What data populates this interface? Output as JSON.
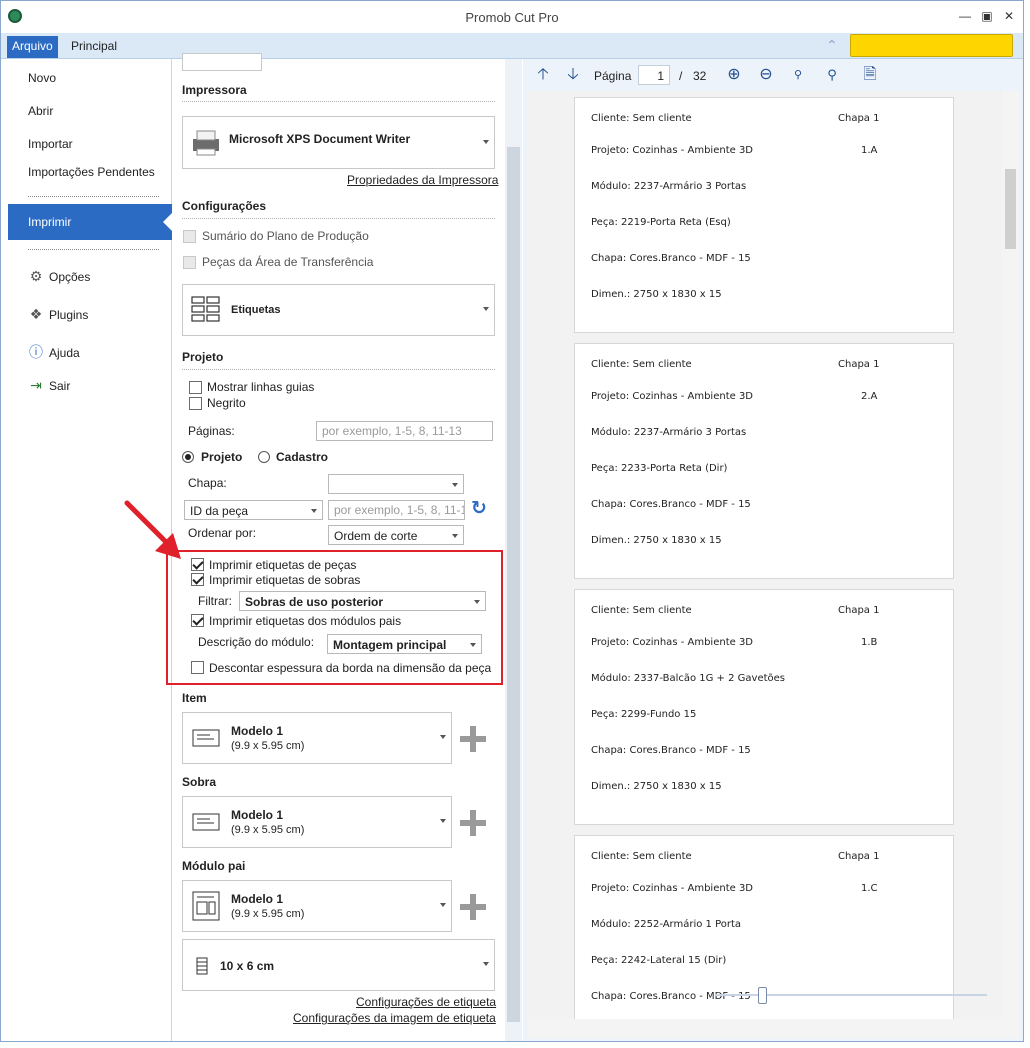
{
  "window": {
    "title": "Promob Cut Pro"
  },
  "menubar": {
    "tabs": [
      "Arquivo",
      "Principal"
    ]
  },
  "sidebar": {
    "items": [
      "Novo",
      "Abrir",
      "Importar",
      "Importações Pendentes",
      "Imprimir",
      "Opções",
      "Plugins",
      "Ajuda",
      "Sair"
    ],
    "active": "Imprimir"
  },
  "printer": {
    "section": "Impressora",
    "name": "Microsoft XPS Document Writer",
    "properties_link": "Propriedades da Impressora"
  },
  "config": {
    "section": "Configurações",
    "opt1": "Sumário do Plano de Produção",
    "opt2": "Peças da Área de Transferência",
    "type": "Etiquetas"
  },
  "project": {
    "section": "Projeto",
    "show_guides": "Mostrar linhas guias",
    "bold": "Negrito",
    "pages_label": "Páginas:",
    "pages_placeholder": "por exemplo, 1-5, 8, 11-13",
    "radio_project": "Projeto",
    "radio_cadastro": "Cadastro",
    "chapa_label": "Chapa:",
    "id_select": "ID da peça",
    "id_placeholder": "por exemplo, 1-5, 8, 11-13",
    "order_label": "Ordenar por:",
    "order_value": "Ordem de corte"
  },
  "labels": {
    "print_parts": "Imprimir etiquetas de peças",
    "print_leftovers": "Imprimir etiquetas de sobras",
    "filter_label": "Filtrar:",
    "filter_value": "Sobras de uso posterior",
    "print_parent_modules": "Imprimir etiquetas dos módulos pais",
    "module_desc_label": "Descrição do módulo:",
    "module_desc_value": "Montagem principal",
    "discount_edge": "Descontar espessura da borda na dimensão da peça"
  },
  "item": {
    "section": "Item",
    "model": "Modelo 1",
    "size": "(9.9 x 5.95 cm)"
  },
  "sobra": {
    "section": "Sobra",
    "model": "Modelo 1",
    "size": "(9.9 x 5.95 cm)"
  },
  "modulo": {
    "section": "Módulo pai",
    "model": "Modelo 1",
    "size": "(9.9 x 5.95 cm)"
  },
  "label_size": "10 x 6 cm",
  "links": {
    "label_config": "Configurações de etiqueta",
    "label_image_config": "Configurações da imagem de etiqueta"
  },
  "preview_toolbar": {
    "page_label": "Página",
    "current_page": "1",
    "separator": "/",
    "total_pages": "32"
  },
  "preview_pages": [
    {
      "cliente": "Cliente: Sem cliente",
      "chapa_id": "Chapa 1",
      "projeto": "Projeto: Cozinhas - Ambiente 3D",
      "code": "1.A",
      "modulo": "Módulo: 2237-Armário 3 Portas",
      "peca": "Peça: 2219-Porta Reta (Esq)",
      "chapa": "Chapa: Cores.Branco - MDF - 15",
      "dimen": "Dimen.: 2750 x 1830 x 15"
    },
    {
      "cliente": "Cliente: Sem cliente",
      "chapa_id": "Chapa 1",
      "projeto": "Projeto: Cozinhas - Ambiente 3D",
      "code": "2.A",
      "modulo": "Módulo: 2237-Armário 3 Portas",
      "peca": "Peça: 2233-Porta Reta (Dir)",
      "chapa": "Chapa: Cores.Branco - MDF - 15",
      "dimen": "Dimen.: 2750 x 1830 x 15"
    },
    {
      "cliente": "Cliente: Sem cliente",
      "chapa_id": "Chapa 1",
      "projeto": "Projeto: Cozinhas - Ambiente 3D",
      "code": "1.B",
      "modulo": "Módulo: 2337-Balcão 1G + 2 Gavetões",
      "peca": "Peça: 2299-Fundo 15",
      "chapa": "Chapa: Cores.Branco - MDF - 15",
      "dimen": "Dimen.: 2750 x 1830 x 15"
    },
    {
      "cliente": "Cliente: Sem cliente",
      "chapa_id": "Chapa 1",
      "projeto": "Projeto: Cozinhas - Ambiente 3D",
      "code": "1.C",
      "modulo": "Módulo: 2252-Armário 1 Porta",
      "peca": "Peça: 2242-Lateral 15 (Dir)",
      "chapa": "Chapa: Cores.Branco - MDF - 15",
      "dimen": ""
    }
  ],
  "colors": {
    "accent": "#2c6bc4",
    "highlight_border": "#e0202a",
    "yellow": "#ffd500"
  },
  "icons": [
    "gear-icon",
    "puzzle-icon",
    "help-icon",
    "exit-icon",
    "printer-icon",
    "arrow-up-icon",
    "arrow-down-icon",
    "zoom-in-icon",
    "zoom-out-icon",
    "zoom-100-icon",
    "zoom-fit-icon",
    "export-icon",
    "refresh-icon",
    "plus-icon"
  ]
}
